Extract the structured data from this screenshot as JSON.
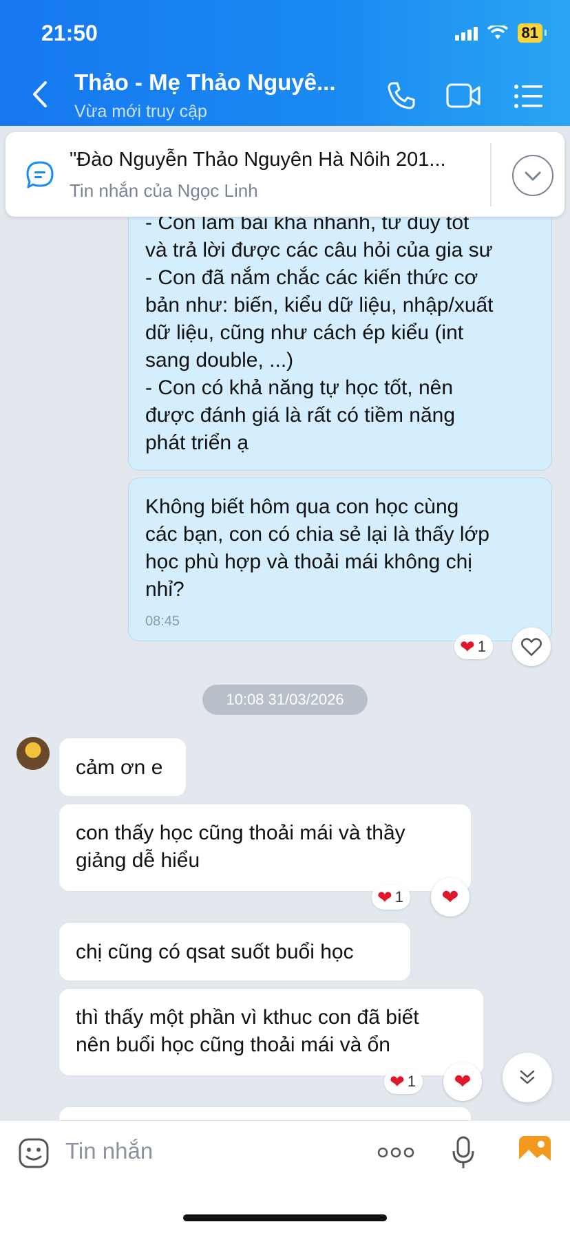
{
  "status_bar": {
    "time": "21:50",
    "battery": "81"
  },
  "header": {
    "title": "Thảo - Mẹ Thảo Nguyê...",
    "subtitle": "Vừa mới truy cập",
    "icons": [
      "back-icon",
      "phone-icon",
      "video-call-icon",
      "menu-list-icon"
    ]
  },
  "pinned": {
    "text": "\"Đào Nguyễn Thảo Nguyên Hà Nôih 201...",
    "sub": "Tin nhắn của Ngọc Linh"
  },
  "messages": [
    {
      "side": "sent",
      "lines": [
        "- Con làm bài khá nhanh, tư duy tốt",
        "và trả lời được các câu hỏi của gia sư",
        "- Con đã nắm chắc các kiến thức cơ",
        "bản như: biến, kiểu dữ liệu, nhập/xuất",
        "dữ liệu, cũng như cách ép kiểu (int",
        "sang double, ...)",
        "- Con có khả năng tự học tốt, nên",
        "được đánh giá là rất có tiềm năng",
        "phát triển ạ"
      ]
    },
    {
      "side": "sent",
      "lines": [
        "Không biết hôm qua con học cùng",
        "các bạn, con có chia sẻ lại là thấy lớp",
        "học phù hợp và thoải mái không chị",
        "nhỉ?"
      ],
      "time": "08:45",
      "reaction_count": "1"
    },
    {
      "side": "received",
      "lines": [
        "cảm ơn e"
      ]
    },
    {
      "side": "received",
      "lines": [
        "con thấy học cũng thoải mái và thầy",
        "giảng dễ hiểu"
      ],
      "reaction_count": "1"
    },
    {
      "side": "received",
      "lines": [
        "chị cũng có qsat suốt buổi học"
      ]
    },
    {
      "side": "received",
      "lines": [
        "thì thấy một phần vì kthuc con đã biết",
        "nên buổi học cũng thoải mái và ổn"
      ],
      "reaction_count": "1"
    }
  ],
  "date_separator": "10:08 31/03/2026",
  "composer": {
    "placeholder": "Tin nhắn"
  },
  "colors": {
    "header": "#1a8bf2",
    "sent_bubble": "#d5eefd",
    "heart": "#e0162b"
  }
}
